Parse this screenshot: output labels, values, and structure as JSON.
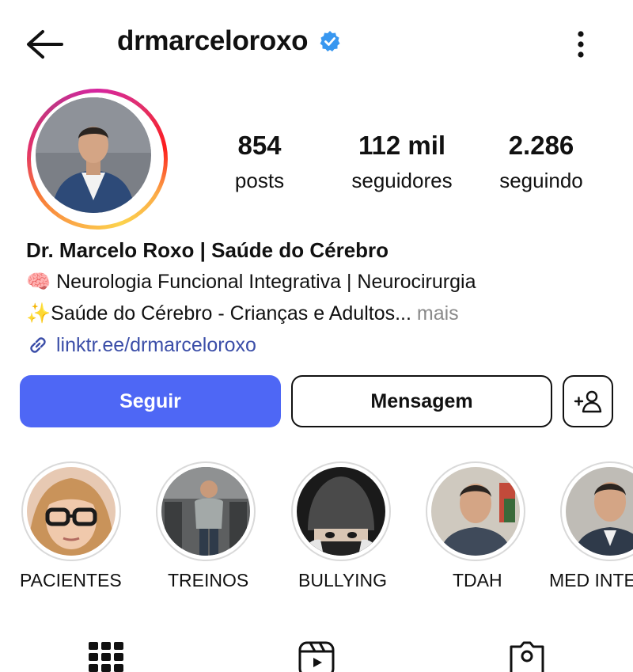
{
  "header": {
    "username": "drmarceloroxo",
    "icons": {
      "back": "arrow-left-icon",
      "verified": "verified-badge-icon",
      "more": "more-vertical-icon"
    }
  },
  "stats": [
    {
      "value": "854",
      "label": "posts"
    },
    {
      "value": "112 mil",
      "label": "seguidores"
    },
    {
      "value": "2.286",
      "label": "seguindo"
    }
  ],
  "bio": {
    "name": "Dr. Marcelo Roxo | Saúde do Cérebro",
    "line1_emoji": "🧠",
    "line1": "Neurologia Funcional Integrativa | Neurocirurgia",
    "line2_emoji": "✨",
    "line2": "Saúde do Cérebro - Crianças e Adultos...",
    "more": " mais",
    "link": "linktr.ee/drmarceloroxo"
  },
  "actions": {
    "follow": "Seguir",
    "message": "Mensagem",
    "add_person_icon": "add-person-icon"
  },
  "highlights": [
    {
      "label": "PACIENTES"
    },
    {
      "label": "TREINOS"
    },
    {
      "label": "BULLYING"
    },
    {
      "label": "TDAH"
    },
    {
      "label": "MED INTE"
    }
  ],
  "tabs": [
    {
      "icon": "grid-icon"
    },
    {
      "icon": "reels-icon"
    },
    {
      "icon": "tagged-icon"
    }
  ],
  "colors": {
    "follow_button": "#4e67f5",
    "link": "#3b4ea8",
    "verified": "#3897f0"
  }
}
